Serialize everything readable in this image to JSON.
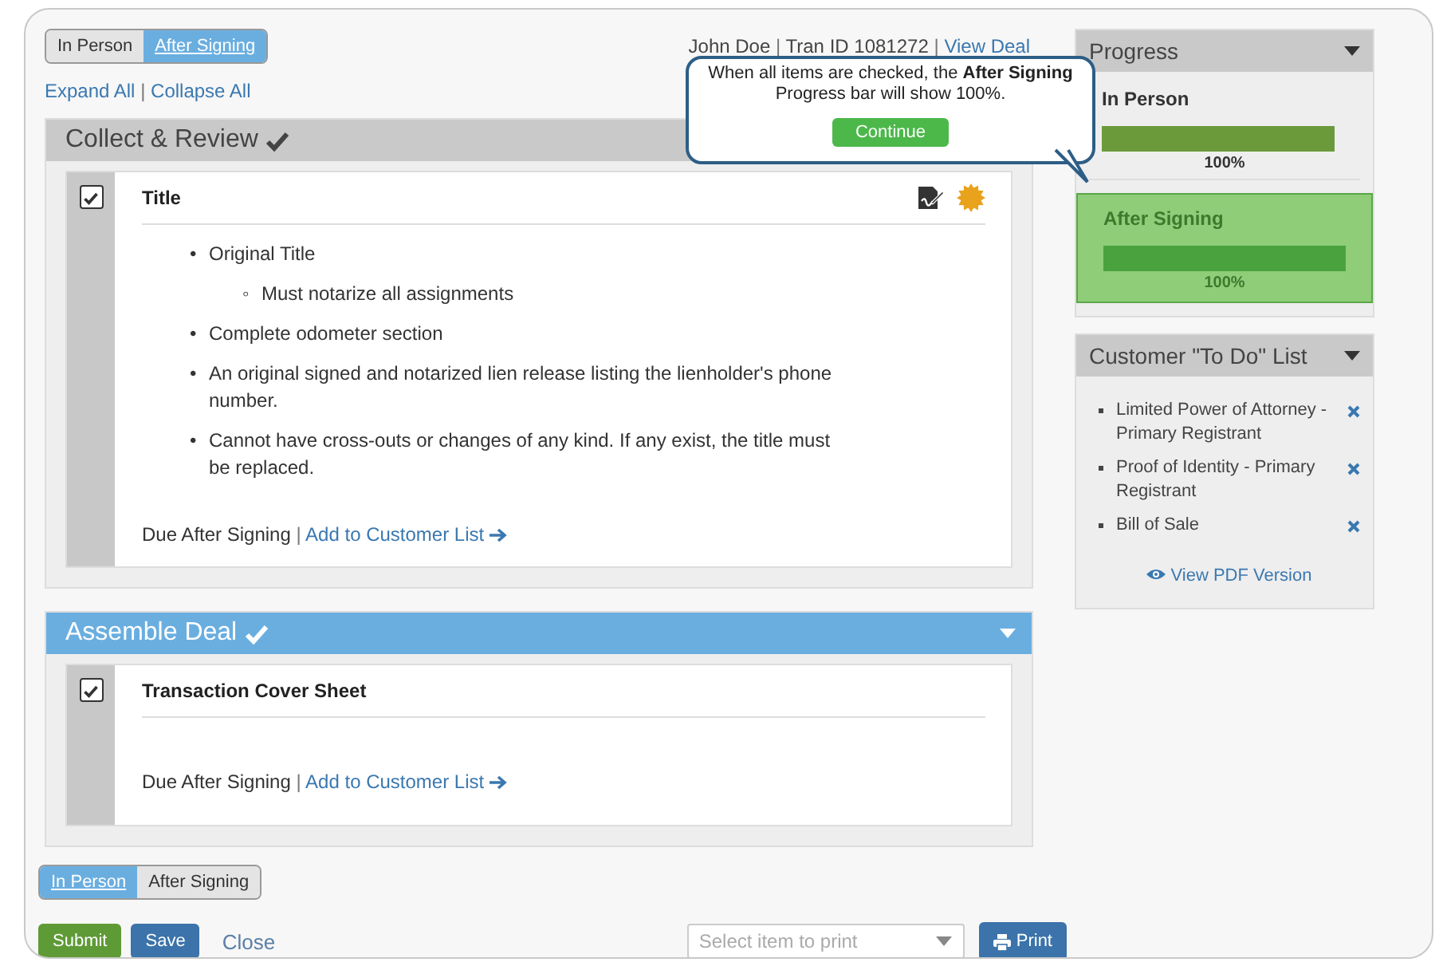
{
  "top_toggle": [
    {
      "label": "In Person",
      "selected": false
    },
    {
      "label": "After Signing",
      "selected": true
    }
  ],
  "deal_info": [
    {
      "text": "John Doe",
      "kind": "text"
    },
    {
      "text": "|",
      "kind": "separator"
    },
    {
      "text": "Tran ID 1081272",
      "kind": "text"
    },
    {
      "text": "|",
      "kind": "separator"
    },
    {
      "text": "View Deal",
      "kind": "link"
    }
  ],
  "view_links": [
    {
      "text": "Expand All",
      "kind": "link"
    },
    {
      "text": "|",
      "kind": "separator"
    },
    {
      "text": "Collapse All",
      "kind": "link"
    }
  ],
  "sections": [
    {
      "title": "Collect & Review",
      "kind": "gray",
      "complete": true,
      "items": [
        {
          "title": "Title",
          "checked": true,
          "has_icons": true,
          "bullets": [
            {
              "marker": "•",
              "text": "Original Title",
              "children": [
                {
                  "marker": "◦",
                  "text": "Must notarize all assignments"
                }
              ]
            },
            {
              "marker": "•",
              "text": "Complete odometer section"
            },
            {
              "marker": "•",
              "text": "An original signed and notarized lien release listing the lienholder's phone number."
            },
            {
              "marker": "•",
              "text": "Cannot have cross-outs or changes of any kind. If any exist, the title must be replaced."
            }
          ],
          "due": "Due After Signing",
          "separator": "|",
          "link": "Add to Customer List"
        }
      ]
    },
    {
      "title": "Assemble Deal",
      "kind": "blue",
      "complete": true,
      "collapsible": true,
      "items": [
        {
          "title": "Transaction Cover Sheet",
          "checked": true,
          "has_icons": false,
          "due": "Due After Signing",
          "separator": "|",
          "link": "Add to Customer List"
        }
      ]
    }
  ],
  "tooltip": {
    "text": "When all items are checked, the **After Signing** Progress bar will show 100%.",
    "button": "Continue"
  },
  "progress": {
    "title": "Progress",
    "bars": [
      {
        "label": "In Person",
        "level": 1,
        "reading": "100%",
        "selected": false
      },
      {
        "label": "After Signing",
        "level": 1,
        "reading": "100%",
        "selected": true
      }
    ]
  },
  "todo": {
    "title": "Customer \"To Do\" List",
    "items": [
      {
        "text": "Limited Power of Attorney - Primary Registrant"
      },
      {
        "text": "Proof of Identity - Primary Registrant"
      },
      {
        "text": "Bill of Sale"
      }
    ],
    "link": "View PDF Version"
  },
  "bottom_toggle": [
    {
      "label": "In Person",
      "selected": true
    },
    {
      "label": "After Signing",
      "selected": false
    }
  ],
  "footer": {
    "buttons": [
      {
        "label": "Submit",
        "kind": "submit"
      },
      {
        "label": "Save",
        "kind": "save"
      }
    ],
    "close": "Close",
    "print_select": {
      "placeholder": "Select item to print"
    },
    "print_button": "Print"
  }
}
